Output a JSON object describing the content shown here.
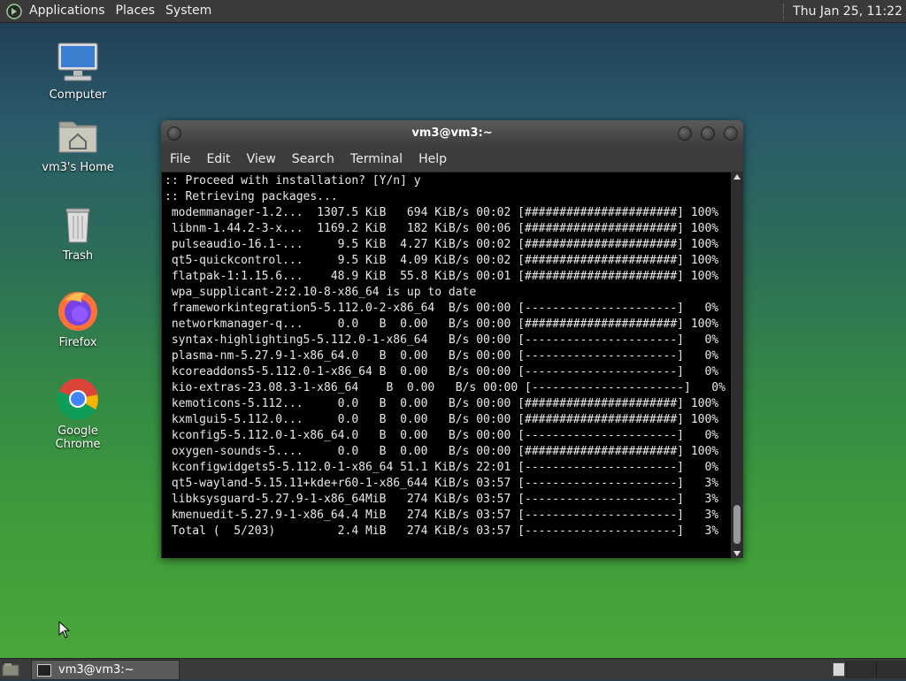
{
  "top_panel": {
    "menu": [
      "Applications",
      "Places",
      "System"
    ],
    "clock": "Thu Jan 25, 11:22"
  },
  "desktop_icons": [
    {
      "label": "Computer"
    },
    {
      "label": "vm3's Home"
    },
    {
      "label": "Trash"
    },
    {
      "label": "Firefox"
    },
    {
      "label": "Google Chrome"
    }
  ],
  "window": {
    "title": "vm3@vm3:~",
    "menu": [
      "File",
      "Edit",
      "View",
      "Search",
      "Terminal",
      "Help"
    ],
    "lines": [
      ":: Proceed with installation? [Y/n] y",
      ":: Retrieving packages...",
      " modemmanager-1.2...  1307.5 KiB   694 KiB/s 00:02 [######################] 100%",
      " libnm-1.44.2-3-x...  1169.2 KiB   182 KiB/s 00:06 [######################] 100%",
      " pulseaudio-16.1-...     9.5 KiB  4.27 KiB/s 00:02 [######################] 100%",
      " qt5-quickcontrol...     9.5 KiB  4.09 KiB/s 00:02 [######################] 100%",
      " flatpak-1:1.15.6...    48.9 KiB  55.8 KiB/s 00:01 [######################] 100%",
      " wpa_supplicant-2:2.10-8-x86_64 is up to date",
      " frameworkintegration5-5.112.0-2-x86_64  B/s 00:00 [----------------------]   0%",
      " networkmanager-q...     0.0   B  0.00   B/s 00:00 [######################] 100%",
      " syntax-highlighting5-5.112.0-1-x86_64   B/s 00:00 [----------------------]   0%",
      " plasma-nm-5.27.9-1-x86_64.0   B  0.00   B/s 00:00 [----------------------]   0%",
      " kcoreaddons5-5.112.0-1-x86_64 B  0.00   B/s 00:00 [----------------------]   0%",
      " kio-extras-23.08.3-1-x86_64    B  0.00   B/s 00:00 [----------------------]   0%",
      " kemoticons-5.112...     0.0   B  0.00   B/s 00:00 [######################] 100%",
      " kxmlgui5-5.112.0...     0.0   B  0.00   B/s 00:00 [######################] 100%",
      " kconfig5-5.112.0-1-x86_64.0   B  0.00   B/s 00:00 [----------------------]   0%",
      " oxygen-sounds-5....     0.0   B  0.00   B/s 00:00 [######################] 100%",
      " kconfigwidgets5-5.112.0-1-x86_64 51.1 KiB/s 22:01 [----------------------]   0%",
      " qt5-wayland-5.15.11+kde+r60-1-x86_644 KiB/s 03:57 [----------------------]   3%",
      " libksysguard-5.27.9-1-x86_64MiB   274 KiB/s 03:57 [----------------------]   3%",
      " kmenuedit-5.27.9-1-x86_64.4 MiB   274 KiB/s 03:57 [----------------------]   3%",
      " Total (  5/203)         2.4 MiB   274 KiB/s 03:57 [----------------------]   3%"
    ]
  },
  "taskbar": {
    "task_label": "vm3@vm3:~"
  }
}
